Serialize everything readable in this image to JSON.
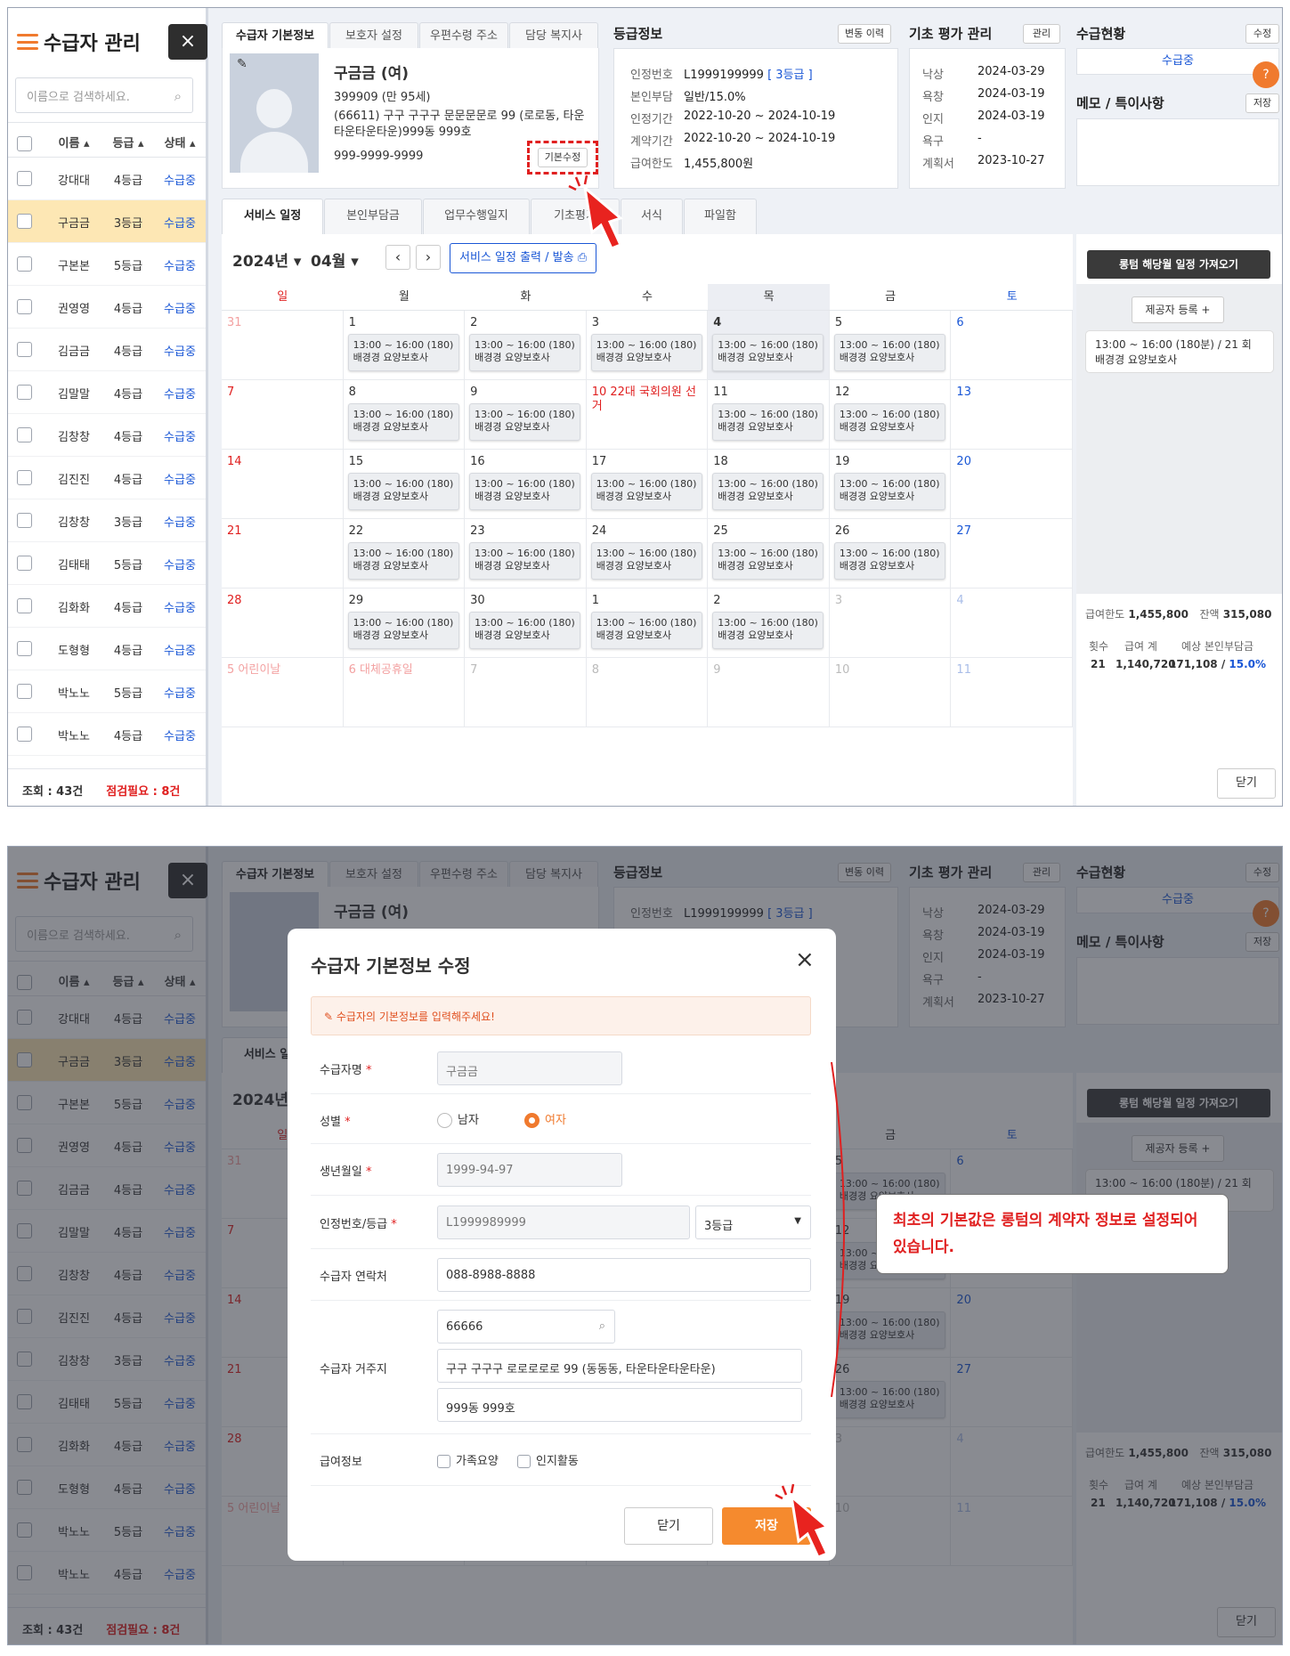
{
  "sidebar": {
    "title": "수급자 관리",
    "close": "×",
    "search_placeholder": "이름으로 검색하세요.",
    "head": {
      "name": "이름 ▴",
      "grade": "등급 ▴",
      "status": "상태 ▴"
    },
    "rows": [
      {
        "name": "강대대",
        "grade": "4등급",
        "status": "수급중"
      },
      {
        "name": "구금금",
        "grade": "3등급",
        "status": "수급중"
      },
      {
        "name": "구본본",
        "grade": "5등급",
        "status": "수급중"
      },
      {
        "name": "권영영",
        "grade": "4등급",
        "status": "수급중"
      },
      {
        "name": "김금금",
        "grade": "4등급",
        "status": "수급중"
      },
      {
        "name": "김말말",
        "grade": "4등급",
        "status": "수급중"
      },
      {
        "name": "김창창",
        "grade": "4등급",
        "status": "수급중"
      },
      {
        "name": "김진진",
        "grade": "4등급",
        "status": "수급중"
      },
      {
        "name": "김창창",
        "grade": "3등급",
        "status": "수급중"
      },
      {
        "name": "김태태",
        "grade": "5등급",
        "status": "수급중"
      },
      {
        "name": "김화화",
        "grade": "4등급",
        "status": "수급중"
      },
      {
        "name": "도형형",
        "grade": "4등급",
        "status": "수급중"
      },
      {
        "name": "박노노",
        "grade": "5등급",
        "status": "수급중"
      },
      {
        "name": "박노노",
        "grade": "4등급",
        "status": "수급중"
      }
    ],
    "footer_count": "조회 : 43건",
    "footer_check": "점검필요 : 8건"
  },
  "info_tabs": [
    "수급자 기본정보",
    "보호자 설정",
    "우편수령 주소",
    "담당 복지사"
  ],
  "profile": {
    "name": "구금금 (여)",
    "birth": "399909 (만 95세)",
    "address": "(66611) 구구 구구구 문문문문로 99 (로로동, 타운타운타운타운)999동 999호",
    "phone": "999-9999-9999",
    "edit_btn": "기본수정"
  },
  "grade_info": {
    "title": "등급정보",
    "history_btn": "변동 이력",
    "rows": [
      {
        "label": "인정번호",
        "value": "L1999199999",
        "extra": "[ 3등급 ]"
      },
      {
        "label": "본인부담",
        "value": "일반/15.0%"
      },
      {
        "label": "인정기간",
        "value": "2022-10-20 ~ 2024-10-19"
      },
      {
        "label": "계약기간",
        "value": "2022-10-20 ~ 2024-10-19"
      },
      {
        "label": "급여한도",
        "value": "1,455,800원"
      }
    ]
  },
  "eval": {
    "title": "기초 평가 관리",
    "manage_btn": "관리",
    "rows": [
      {
        "label": "낙상",
        "value": "2024-03-29"
      },
      {
        "label": "욕창",
        "value": "2024-03-19"
      },
      {
        "label": "인지",
        "value": "2024-03-19"
      },
      {
        "label": "욕구",
        "value": "-"
      },
      {
        "label": "계획서",
        "value": "2023-10-27"
      }
    ]
  },
  "status": {
    "title": "수급현황",
    "edit_btn": "수정",
    "value": "수급중",
    "memo_title": "메모 / 특이사항",
    "save_btn": "저장"
  },
  "service_tabs": [
    "서비스 일정",
    "본인부담금",
    "업무수행일지",
    "기초평가",
    "서식",
    "파일함"
  ],
  "calendar": {
    "year": "2024년",
    "month": "04월",
    "print_btn": "서비스 일정 출력 / 발송",
    "weekdays": [
      "일",
      "월",
      "화",
      "수",
      "목",
      "금",
      "토"
    ],
    "event_line1": "13:00 ~ 16:00 (180)",
    "event_line2": "배경경 요양보호사",
    "days": [
      "31",
      "1",
      "2",
      "3",
      "4",
      "5",
      "6",
      "7",
      "8",
      "9",
      "10 22대 국회의원 선거",
      "11",
      "12",
      "13",
      "14",
      "15",
      "16",
      "17",
      "18",
      "19",
      "20",
      "21",
      "22",
      "23",
      "24",
      "25",
      "26",
      "27",
      "28",
      "29",
      "30",
      "1",
      "2",
      "3",
      "4",
      "5 어린이날",
      "6 대체공휴일",
      "7",
      "8",
      "9",
      "10",
      "11"
    ]
  },
  "right": {
    "import_btn": "롱텀 해당월 일정 가져오기",
    "provider_btn": "제공자 등록 +",
    "sched_line1": "13:00 ~ 16:00 (180분) / 21 회",
    "sched_line2": "배경경 요양보호사",
    "limit_label": "급여한도",
    "limit": "1,455,800",
    "remain_label": "잔액",
    "remain": "315,080",
    "cnt_label": "횟수",
    "total_label": "급여 계",
    "expect_label": "예상 본인부담금",
    "cnt": "21",
    "total": "1,140,720",
    "expect": "171,108 /",
    "pct": "15.0%",
    "close_btn": "닫기"
  },
  "modal": {
    "title": "수급자 기본정보 수정",
    "notice": "수급자의 기본정보를 입력해주세요!",
    "name_label": "수급자명",
    "name": "구금금",
    "gender_label": "성별",
    "male": "남자",
    "female": "여자",
    "birth_label": "생년월일",
    "birth": "1999-94-97",
    "cert_label": "인정번호/등급",
    "cert": "L1999989999",
    "grade": "3등급",
    "phone_label": "수급자 연락처",
    "phone": "088-8988-8888",
    "addr_label": "수급자 거주지",
    "zip": "66666",
    "addr1": "구구 구구구 로로로로로 99 (동동동, 타운타운타운타운)",
    "addr2": "999동 999호",
    "benefit_label": "급여정보",
    "opt1": "가족요양",
    "opt2": "인지활동",
    "close_btn": "닫기",
    "save_btn": "저장"
  },
  "callout": "최초의 기본값은 롱텀의 계약자 정보로 설정되어 있습니다.",
  "colors": {
    "accent": "#f07a2e",
    "blue": "#1a57d6",
    "red": "#e02020"
  }
}
